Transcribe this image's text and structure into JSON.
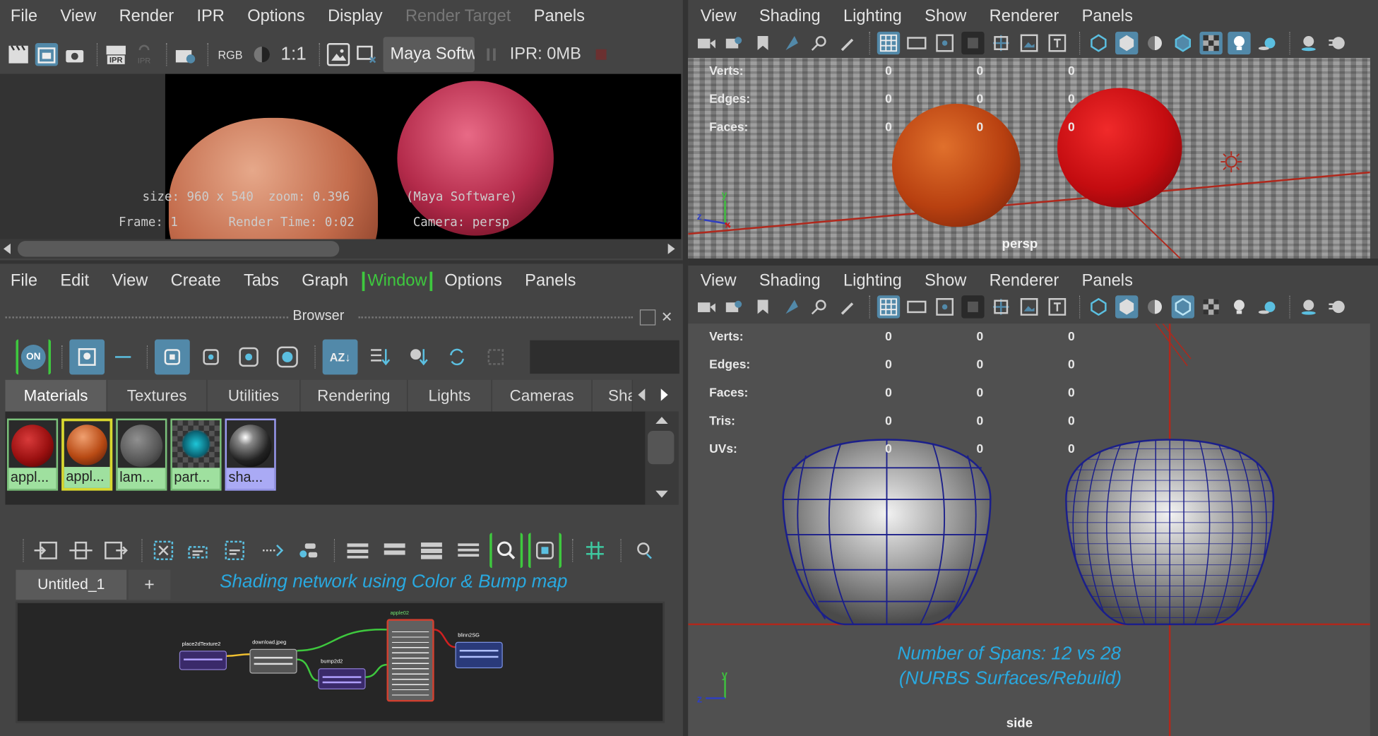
{
  "render_view": {
    "menu": [
      "File",
      "View",
      "Render",
      "IPR",
      "Options",
      "Display",
      "Render Target",
      "Panels"
    ],
    "toolbar": {
      "rgb": "RGB",
      "ratio": "1:1",
      "renderer": "Maya Softw",
      "ipr_memory": "IPR: 0MB",
      "ipr_label": "IPR",
      "ipr_label_dim": "IPR"
    },
    "overlay": {
      "size": "size: 960 x 540  zoom: 0.396",
      "renderer": "(Maya Software)",
      "frame": "Frame: 1",
      "render_time": "Render Time: 0:02",
      "camera": "Camera: persp"
    }
  },
  "persp_view": {
    "menu": [
      "View",
      "Shading",
      "Lighting",
      "Show",
      "Renderer",
      "Panels"
    ],
    "stats": [
      {
        "label": "Verts:",
        "values": [
          "0",
          "0",
          "0"
        ]
      },
      {
        "label": "Edges:",
        "values": [
          "0",
          "0",
          "0"
        ]
      },
      {
        "label": "Faces:",
        "values": [
          "0",
          "0",
          "0"
        ]
      }
    ],
    "camera_label": "persp",
    "axis_y": "y",
    "axis_z": "z",
    "axis_x": "x"
  },
  "hypershade": {
    "menu": [
      "File",
      "Edit",
      "View",
      "Create",
      "Tabs",
      "Graph",
      "Window",
      "Options",
      "Panels"
    ],
    "browser_title": "Browser",
    "on_label": "ON",
    "tabs": [
      "Materials",
      "Textures",
      "Utilities",
      "Rendering",
      "Lights",
      "Cameras",
      "Sha"
    ],
    "swatches": [
      {
        "label": "appl...",
        "kind": "red-apple"
      },
      {
        "label": "appl...",
        "kind": "orange-apple"
      },
      {
        "label": "lam...",
        "kind": "lambert"
      },
      {
        "label": "part...",
        "kind": "particle"
      },
      {
        "label": "sha...",
        "kind": "shader"
      }
    ],
    "graph_tab": "Untitled_1",
    "add_tab": "+",
    "caption": "Shading network using Color & Bump map",
    "nodes": {
      "place2d": "place2dTexture2",
      "download": "download.jpeg",
      "bump": "bump2d2",
      "apple": "apple02",
      "blinn": "blinn2SG"
    }
  },
  "side_view": {
    "menu": [
      "View",
      "Shading",
      "Lighting",
      "Show",
      "Renderer",
      "Panels"
    ],
    "stats": [
      {
        "label": "Verts:",
        "values": [
          "0",
          "0",
          "0"
        ]
      },
      {
        "label": "Edges:",
        "values": [
          "0",
          "0",
          "0"
        ]
      },
      {
        "label": "Faces:",
        "values": [
          "0",
          "0",
          "0"
        ]
      },
      {
        "label": "Tris:",
        "values": [
          "0",
          "0",
          "0"
        ]
      },
      {
        "label": "UVs:",
        "values": [
          "0",
          "0",
          "0"
        ]
      }
    ],
    "caption_line1": "Number of Spans: 12 vs 28",
    "caption_line2": "(NURBS Surfaces/Rebuild)",
    "camera_label": "side",
    "axis_y": "y",
    "axis_z": "z"
  },
  "colors": {
    "accent": "#5289a9",
    "highlight_green": "#3ec83e",
    "caption_blue": "#29a9e0",
    "grid_red": "#b0281c",
    "wire_blue": "#1b1f8a"
  }
}
